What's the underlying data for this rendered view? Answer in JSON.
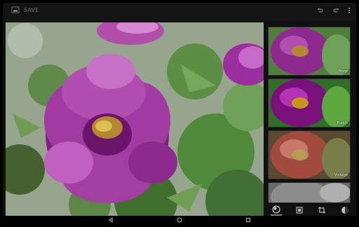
{
  "top_bar": {
    "save_label": "SAVE",
    "icons": [
      "save-icon",
      "undo-icon",
      "redo-icon",
      "more-vert-icon"
    ]
  },
  "filters": [
    {
      "label": "None"
    },
    {
      "label": "Punch"
    },
    {
      "label": "Vintage"
    },
    {
      "label": ""
    }
  ],
  "tools": [
    "filters-icon",
    "frames-icon",
    "crop-icon",
    "adjust-icon"
  ],
  "nav": [
    "back-icon",
    "home-icon",
    "recents-icon"
  ],
  "colors": {
    "topbar_bg": "#141414",
    "panel_bg": "#101010",
    "icon_color": "#8a8a8a",
    "flower": "#9b2f9f",
    "leaf": "#4f8a3a"
  }
}
